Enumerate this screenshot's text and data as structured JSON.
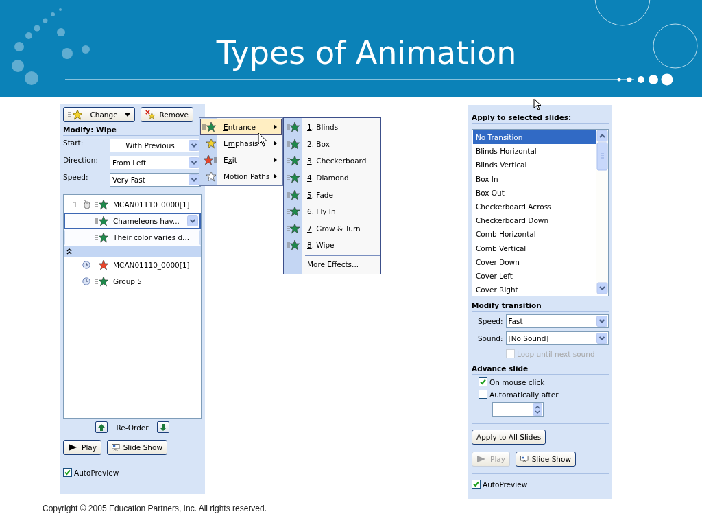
{
  "title": "Types of Animation",
  "animation_pane": {
    "change_button": "Change",
    "remove_button": "Remove",
    "heading": "Modify: Wipe",
    "fields": [
      {
        "label": "Start:",
        "value": "With Previous"
      },
      {
        "label": "Direction:",
        "value": "From Left"
      },
      {
        "label": "Speed:",
        "value": "Very Fast"
      }
    ],
    "effects": [
      {
        "kind": "entrance",
        "number": "1",
        "on_click": true,
        "name": "MCAN01110_0000[1]",
        "selected": false,
        "in_group": false
      },
      {
        "kind": "entrance",
        "name": "Chameleons hav...",
        "selected": true,
        "in_group": true
      },
      {
        "kind": "entrance",
        "name": "Their color varies d...",
        "selected": false,
        "in_group": true
      },
      {
        "kind": "collapse"
      },
      {
        "kind": "exit",
        "on_click": false,
        "name": "MCAN01110_0000[1]",
        "selected": false,
        "in_group": false
      },
      {
        "kind": "entrance",
        "on_click": false,
        "name": "Group 5",
        "selected": false,
        "in_group": false
      }
    ],
    "reorder": "Re-Order",
    "play_button": "Play",
    "slideshow_button": "Slide Show",
    "autopreview": {
      "label": "AutoPreview",
      "checked": true
    }
  },
  "effect_menu": {
    "items": [
      {
        "kind": "entrance",
        "key": "E",
        "post": "ntrance",
        "selected": true
      },
      {
        "kind": "emphasis",
        "pre": "E",
        "key": "m",
        "post": "phasis",
        "selected": false
      },
      {
        "kind": "exit",
        "pre": "E",
        "key": "x",
        "post": "it",
        "selected": false
      },
      {
        "kind": "motion",
        "pre": "Motion ",
        "key": "P",
        "post": "aths",
        "selected": false
      }
    ]
  },
  "entrance_submenu": {
    "items": [
      {
        "kind": "effect",
        "key": "1",
        "post": ". Blinds"
      },
      {
        "kind": "effect",
        "key": "2",
        "post": ". Box"
      },
      {
        "kind": "effect",
        "key": "3",
        "post": ". Checkerboard"
      },
      {
        "kind": "effect",
        "key": "4",
        "post": ". Diamond"
      },
      {
        "kind": "effect",
        "key": "5",
        "post": ". Fade"
      },
      {
        "kind": "effect",
        "key": "6",
        "post": ". Fly In"
      },
      {
        "kind": "effect",
        "key": "7",
        "post": ". Grow & Turn"
      },
      {
        "kind": "effect",
        "key": "8",
        "post": ". Wipe"
      },
      {
        "kind": "more",
        "key": "M",
        "post": "ore Effects..."
      }
    ]
  },
  "transition_pane": {
    "heading": "Apply to selected slides:",
    "transitions": [
      {
        "label": "No Transition",
        "selected": true
      },
      {
        "label": "Blinds Horizontal",
        "selected": false
      },
      {
        "label": "Blinds Vertical",
        "selected": false
      },
      {
        "label": "Box In",
        "selected": false
      },
      {
        "label": "Box Out",
        "selected": false
      },
      {
        "label": "Checkerboard Across",
        "selected": false
      },
      {
        "label": "Checkerboard Down",
        "selected": false
      },
      {
        "label": "Comb Horizontal",
        "selected": false
      },
      {
        "label": "Comb Vertical",
        "selected": false
      },
      {
        "label": "Cover Down",
        "selected": false
      },
      {
        "label": "Cover Left",
        "selected": false
      },
      {
        "label": "Cover Right",
        "selected": false
      }
    ],
    "modify_heading": "Modify transition",
    "fields": [
      {
        "label": "Speed:",
        "value": "Fast"
      },
      {
        "label": "Sound:",
        "value": "[No Sound]"
      }
    ],
    "loop": {
      "label": "Loop until next sound",
      "checked": false,
      "disabled": true
    },
    "advance_heading": "Advance slide",
    "advance_options": [
      {
        "label": "On mouse click",
        "checked": true
      },
      {
        "label": "Automatically after",
        "checked": false
      }
    ],
    "apply_all_button": "Apply to All Slides",
    "play_button": {
      "label": "Play",
      "disabled": true
    },
    "slideshow_button": "Slide Show",
    "autopreview": {
      "label": "AutoPreview",
      "checked": true
    }
  },
  "footer": "Copyright © 2005 Education Partners, Inc. All rights reserved."
}
